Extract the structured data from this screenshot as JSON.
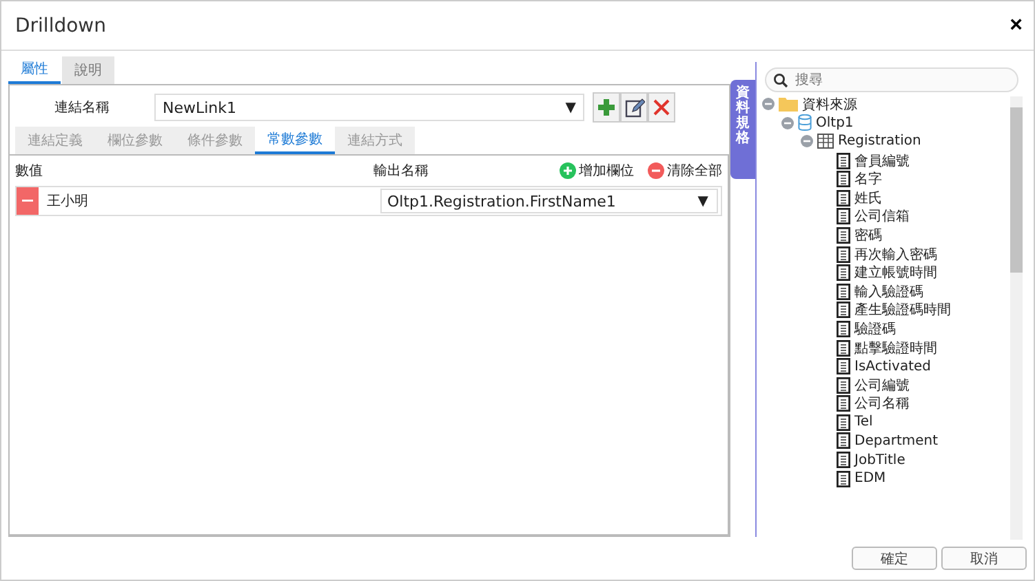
{
  "window": {
    "title": "Drilldown",
    "close": "×"
  },
  "tabs": [
    {
      "label": "屬性",
      "selected": true
    },
    {
      "label": "說明",
      "selected": false
    }
  ],
  "link_name": {
    "label": "連結名稱",
    "value": "NewLink1",
    "caret": "▼"
  },
  "subtabs": [
    {
      "label": "連結定義",
      "selected": false
    },
    {
      "label": "欄位參數",
      "selected": false
    },
    {
      "label": "條件參數",
      "selected": false
    },
    {
      "label": "常數參數",
      "selected": true
    },
    {
      "label": "連結方式",
      "selected": false
    }
  ],
  "table": {
    "columns": [
      "數值",
      "輸出名稱"
    ],
    "add_label": "增加欄位",
    "clear_label": "清除全部",
    "rows": [
      {
        "value": "王小明",
        "output": "Oltp1.Registration.FirstName1",
        "caret": "▼"
      }
    ]
  },
  "side_tab": "資料規格",
  "search": {
    "placeholder": "搜尋"
  },
  "tree": [
    {
      "label": "資料來源",
      "kind": "folder",
      "expanded": true,
      "children": [
        {
          "label": "Oltp1",
          "kind": "database",
          "expanded": true,
          "children": [
            {
              "label": "Registration",
              "kind": "table",
              "expanded": true,
              "children": [
                {
                  "label": "會員編號",
                  "kind": "field"
                },
                {
                  "label": "名字",
                  "kind": "field"
                },
                {
                  "label": "姓氏",
                  "kind": "field"
                },
                {
                  "label": "公司信箱",
                  "kind": "field"
                },
                {
                  "label": "密碼",
                  "kind": "field"
                },
                {
                  "label": "再次輸入密碼",
                  "kind": "field"
                },
                {
                  "label": "建立帳號時間",
                  "kind": "field"
                },
                {
                  "label": "輸入驗證碼",
                  "kind": "field"
                },
                {
                  "label": "產生驗證碼時間",
                  "kind": "field"
                },
                {
                  "label": "驗證碼",
                  "kind": "field"
                },
                {
                  "label": "點擊驗證時間",
                  "kind": "field"
                },
                {
                  "label": "IsActivated",
                  "kind": "field"
                },
                {
                  "label": "公司編號",
                  "kind": "field"
                },
                {
                  "label": "公司名稱",
                  "kind": "field"
                },
                {
                  "label": "Tel",
                  "kind": "field"
                },
                {
                  "label": "Department",
                  "kind": "field"
                },
                {
                  "label": "JobTitle",
                  "kind": "field"
                },
                {
                  "label": "EDM",
                  "kind": "field"
                }
              ]
            }
          ]
        }
      ]
    }
  ],
  "buttons": [
    "確定",
    "取消"
  ]
}
